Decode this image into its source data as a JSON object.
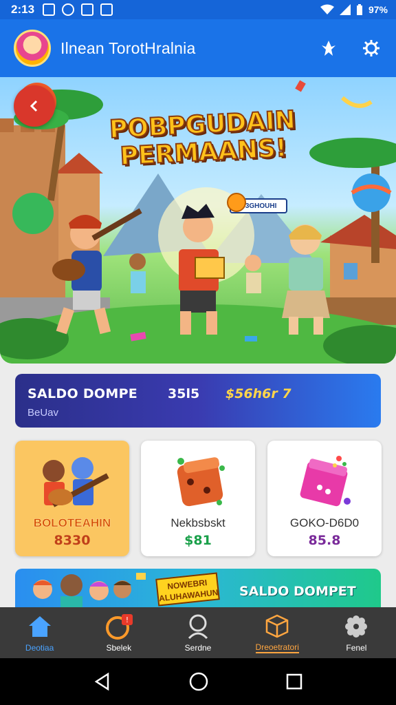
{
  "status_bar": {
    "time": "2:13",
    "battery": "97%",
    "icons": [
      "notification-icon",
      "notification-icon",
      "notification-icon",
      "notification-icon",
      "wifi-icon",
      "signal-icon",
      "battery-icon"
    ]
  },
  "app_bar": {
    "title": "Ilnean TorotHralnia",
    "actions": [
      "notification-bell-icon",
      "settings-icon"
    ]
  },
  "hero": {
    "title_line1": "POBPGUDAIN",
    "title_line2": "PERMAANS!",
    "speech_text": "B3GHOUHI"
  },
  "wallet": {
    "label": "SALDO DOMPE",
    "value1": "35l5",
    "value2": "$56h6r 7",
    "sub": "BeUav"
  },
  "cards": [
    {
      "title": "BOLOTEAHIN",
      "value": "8330"
    },
    {
      "title": "Nekbsbskt",
      "value": "$81"
    },
    {
      "title": "GOKO-D6D0",
      "value": "85.8"
    }
  ],
  "promo": {
    "badge_text": "NOWEBRI ALUHAWAHUN",
    "text": "SALDO DOMPET"
  },
  "bottom_nav": [
    {
      "label": "Deotiaa",
      "icon": "home-icon"
    },
    {
      "label": "Sbelek",
      "icon": "ring-icon"
    },
    {
      "label": "Serdne",
      "icon": "profile-icon"
    },
    {
      "label": "Dreoetratori",
      "icon": "box-icon"
    },
    {
      "label": "Fenel",
      "icon": "gear-icon"
    }
  ],
  "colors": {
    "primary": "#1a73e8",
    "wallet_start": "#2b2f8a",
    "wallet_end": "#2a7bef",
    "nav_bg": "#3a3a3a",
    "active_nav": "#4aa3ff",
    "highlight_nav": "#ffa640"
  }
}
